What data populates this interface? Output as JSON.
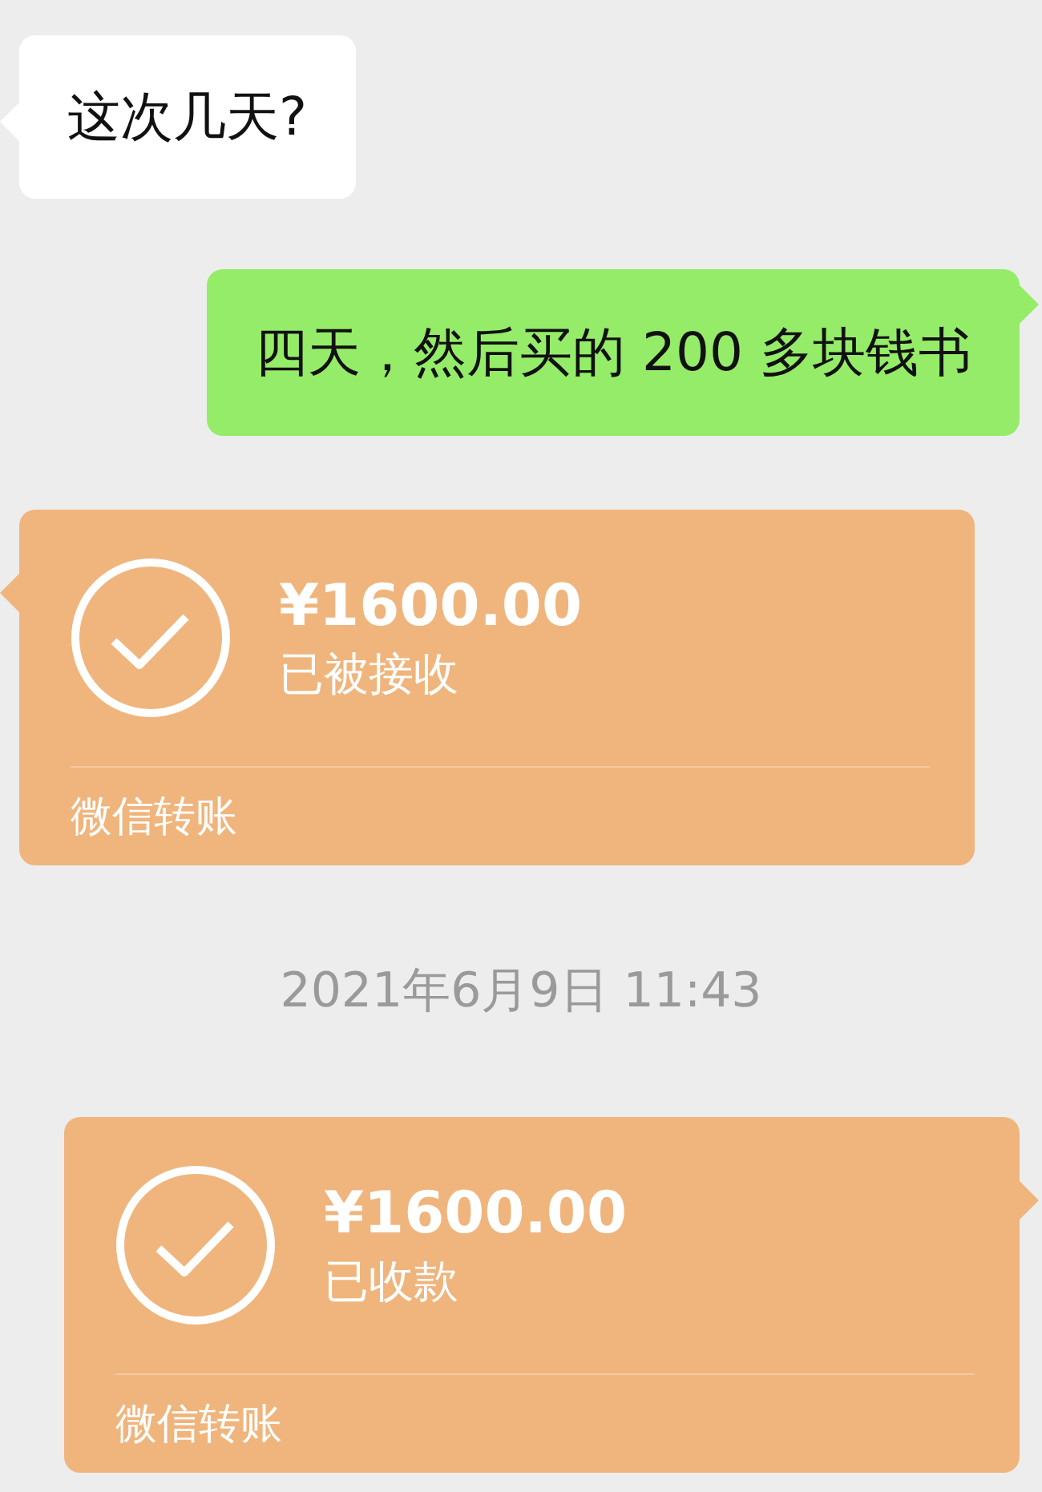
{
  "messages": [
    {
      "kind": "text",
      "outgoing": false,
      "text": "这次几天?"
    },
    {
      "kind": "text",
      "outgoing": true,
      "text": "四天，然后买的 200 多块钱书"
    },
    {
      "kind": "transfer",
      "outgoing": false,
      "amount": "¥1600.00",
      "status": "已被接收",
      "footer": "微信转账"
    },
    {
      "kind": "time",
      "text": "2021年6月9日 11:43"
    },
    {
      "kind": "transfer",
      "outgoing": true,
      "amount": "¥1600.00",
      "status": "已收款",
      "footer": "微信转账"
    }
  ]
}
